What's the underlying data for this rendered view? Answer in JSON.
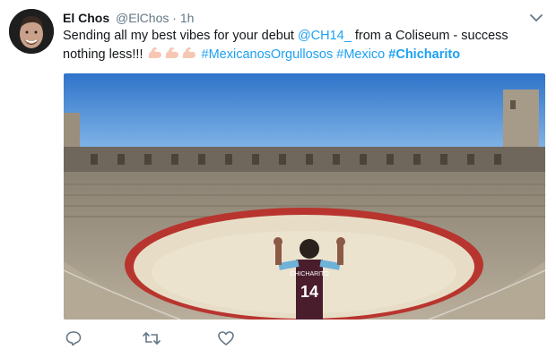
{
  "tweet": {
    "author_name": "El Chos",
    "author_handle": "@ElChos",
    "separator": "·",
    "time": "1h",
    "text_segments": {
      "part1": "Sending all my best vibes for your debut ",
      "mention": "@CH14_",
      "part2": " from a Coliseum - success nothing less!!! ",
      "hashtag1": "#MexicanosOrgullosos",
      "hashtag2": "#Mexico",
      "hashtag3": "#Chicharito"
    },
    "emoji": [
      "flexed-biceps",
      "flexed-biceps",
      "flexed-biceps"
    ],
    "photo": {
      "shirt_name": "CHICHARITO",
      "shirt_number": "14"
    }
  },
  "icons": {
    "caret": "chevron-down-icon",
    "reply": "reply-icon",
    "retweet": "retweet-icon",
    "like": "heart-icon"
  },
  "colors": {
    "link": "#1da1f2",
    "muted": "#657786",
    "text": "#14171a"
  }
}
